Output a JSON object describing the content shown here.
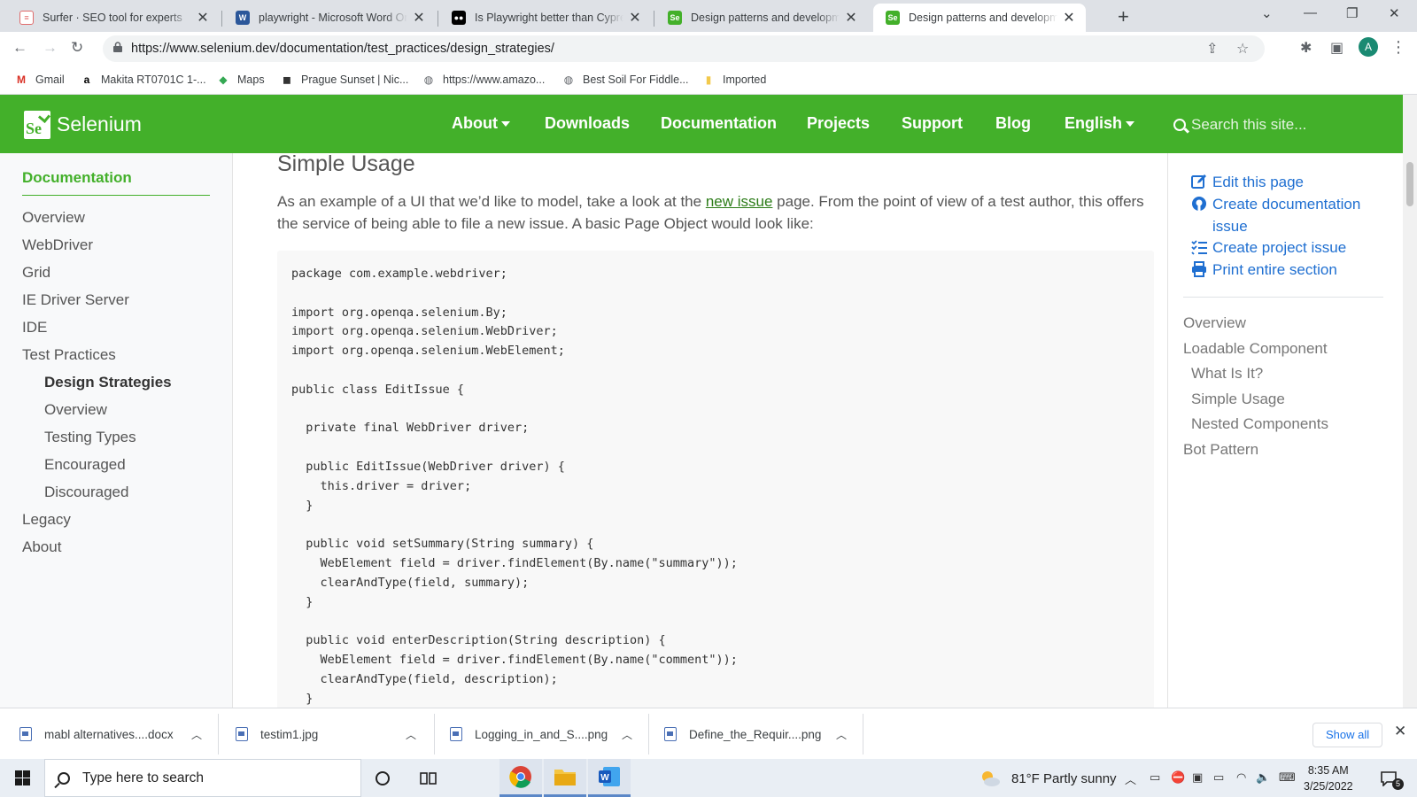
{
  "browser": {
    "tabs": [
      {
        "title": "Surfer · SEO tool for experts",
        "favicon": "surfer-icon",
        "color": "#e8eaed",
        "active": false
      },
      {
        "title": "playwright - Microsoft Word Online",
        "favicon": "word-icon",
        "color": "#2b579a",
        "active": false
      },
      {
        "title": "Is Playwright better than Cypress",
        "favicon": "medium-icon",
        "color": "#000000",
        "active": false
      },
      {
        "title": "Design patterns and development",
        "favicon": "selenium-icon",
        "color": "#43b02a",
        "active": false
      },
      {
        "title": "Design patterns and development",
        "favicon": "selenium-icon",
        "color": "#43b02a",
        "active": true
      }
    ],
    "url": "https://www.selenium.dev/documentation/test_practices/design_strategies/",
    "profile_initial": "A",
    "bookmarks": [
      {
        "label": "Gmail",
        "icon": "gmail-icon"
      },
      {
        "label": "Makita RT0701C 1-...",
        "icon": "amazon-icon"
      },
      {
        "label": "Maps",
        "icon": "maps-icon"
      },
      {
        "label": "Prague Sunset | Nic...",
        "icon": "bookmark-icon"
      },
      {
        "label": "https://www.amazo...",
        "icon": "globe-icon"
      },
      {
        "label": "Best Soil For Fiddle...",
        "icon": "globe-icon"
      },
      {
        "label": "Imported",
        "icon": "folder-icon"
      }
    ]
  },
  "site": {
    "brand": "Selenium",
    "logo_text": "Se",
    "accent": "#43b02a",
    "menu": [
      {
        "label": "About",
        "dropdown": true
      },
      {
        "label": "Downloads",
        "dropdown": false
      },
      {
        "label": "Documentation",
        "dropdown": false
      },
      {
        "label": "Projects",
        "dropdown": false
      },
      {
        "label": "Support",
        "dropdown": false
      },
      {
        "label": "Blog",
        "dropdown": false
      },
      {
        "label": "English",
        "dropdown": true
      }
    ],
    "search_placeholder": "Search this site..."
  },
  "leftnav": {
    "title": "Documentation",
    "items": [
      {
        "label": "Overview",
        "level": 0
      },
      {
        "label": "WebDriver",
        "level": 0
      },
      {
        "label": "Grid",
        "level": 0
      },
      {
        "label": "IE Driver Server",
        "level": 0
      },
      {
        "label": "IDE",
        "level": 0
      },
      {
        "label": "Test Practices",
        "level": 0
      },
      {
        "label": "Design Strategies",
        "level": 1,
        "current": true
      },
      {
        "label": "Overview",
        "level": 1
      },
      {
        "label": "Testing Types",
        "level": 1
      },
      {
        "label": "Encouraged",
        "level": 1
      },
      {
        "label": "Discouraged",
        "level": 1
      },
      {
        "label": "Legacy",
        "level": 0
      },
      {
        "label": "About",
        "level": 0
      }
    ]
  },
  "content": {
    "heading": "Simple Usage",
    "para_before": "As an example of a UI that we’d like to model, take a look at the ",
    "para_link": "new issue",
    "para_after": " page. From the point of view of a test author, this offers the service of being able to file a new issue. A basic Page Object would look like:",
    "code": "package com.example.webdriver;\n\nimport org.openqa.selenium.By;\nimport org.openqa.selenium.WebDriver;\nimport org.openqa.selenium.WebElement;\n\npublic class EditIssue {\n\n  private final WebDriver driver;\n\n  public EditIssue(WebDriver driver) {\n    this.driver = driver;\n  }\n\n  public void setSummary(String summary) {\n    WebElement field = driver.findElement(By.name(\"summary\"));\n    clearAndType(field, summary);\n  }\n\n  public void enterDescription(String description) {\n    WebElement field = driver.findElement(By.name(\"comment\"));\n    clearAndType(field, description);\n  }"
  },
  "rightnav": {
    "actions": [
      {
        "label": "Edit this page",
        "icon": "edit-icon"
      },
      {
        "label": "Create documentation issue",
        "icon": "github-icon"
      },
      {
        "label": "Create project issue",
        "icon": "tasks-icon"
      },
      {
        "label": "Print entire section",
        "icon": "print-icon"
      }
    ],
    "toc": [
      {
        "label": "Overview",
        "level": 0
      },
      {
        "label": "Loadable Component",
        "level": 0
      },
      {
        "label": "What Is It?",
        "level": 1
      },
      {
        "label": "Simple Usage",
        "level": 1
      },
      {
        "label": "Nested Components",
        "level": 1
      },
      {
        "label": "Bot Pattern",
        "level": 0
      }
    ]
  },
  "downloads": {
    "files": [
      "mabl alternatives....docx",
      "testim1.jpg",
      "Logging_in_and_S....png",
      "Define_the_Requir....png"
    ],
    "show_all": "Show all"
  },
  "taskbar": {
    "search_placeholder": "Type here to search",
    "weather": "81°F  Partly sunny",
    "time": "8:35 AM",
    "date": "3/25/2022",
    "notification_count": "5"
  }
}
